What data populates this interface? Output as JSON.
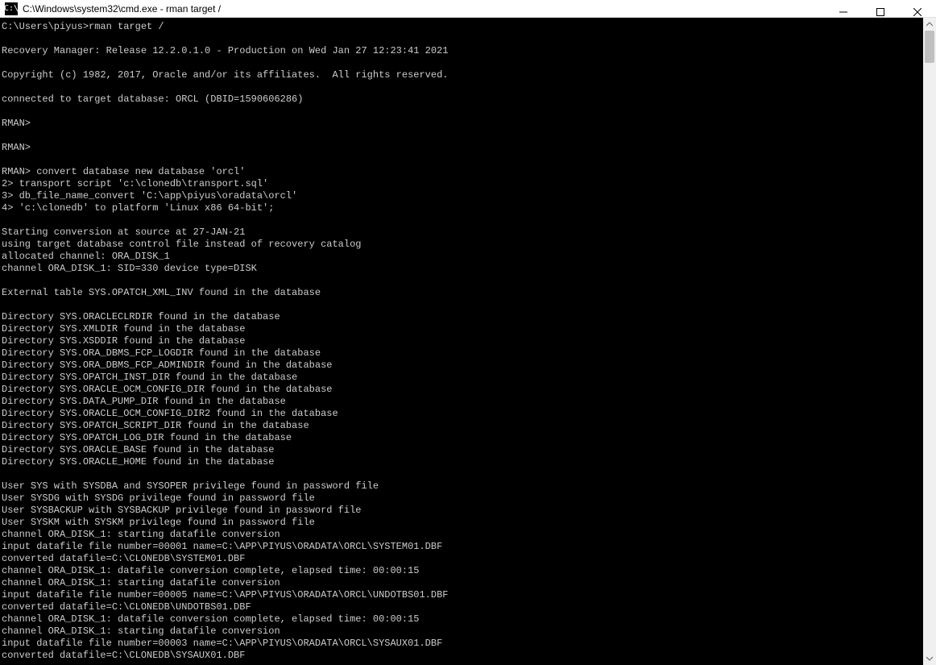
{
  "window": {
    "title": "C:\\Windows\\system32\\cmd.exe - rman  target /",
    "icon_label": "cmd-icon"
  },
  "controls": {
    "minimize": "minimize",
    "maximize": "maximize",
    "close": "close"
  },
  "terminal": {
    "lines": [
      "C:\\Users\\piyus>rman target /",
      "",
      "Recovery Manager: Release 12.2.0.1.0 - Production on Wed Jan 27 12:23:41 2021",
      "",
      "Copyright (c) 1982, 2017, Oracle and/or its affiliates.  All rights reserved.",
      "",
      "connected to target database: ORCL (DBID=1590606286)",
      "",
      "RMAN>",
      "",
      "RMAN>",
      "",
      "RMAN> convert database new database 'orcl'",
      "2> transport script 'c:\\clonedb\\transport.sql'",
      "3> db_file_name_convert 'C:\\app\\piyus\\oradata\\orcl'",
      "4> 'c:\\clonedb' to platform 'Linux x86 64-bit';",
      "",
      "Starting conversion at source at 27-JAN-21",
      "using target database control file instead of recovery catalog",
      "allocated channel: ORA_DISK_1",
      "channel ORA_DISK_1: SID=330 device type=DISK",
      "",
      "External table SYS.OPATCH_XML_INV found in the database",
      "",
      "Directory SYS.ORACLECLRDIR found in the database",
      "Directory SYS.XMLDIR found in the database",
      "Directory SYS.XSDDIR found in the database",
      "Directory SYS.ORA_DBMS_FCP_LOGDIR found in the database",
      "Directory SYS.ORA_DBMS_FCP_ADMINDIR found in the database",
      "Directory SYS.OPATCH_INST_DIR found in the database",
      "Directory SYS.ORACLE_OCM_CONFIG_DIR found in the database",
      "Directory SYS.DATA_PUMP_DIR found in the database",
      "Directory SYS.ORACLE_OCM_CONFIG_DIR2 found in the database",
      "Directory SYS.OPATCH_SCRIPT_DIR found in the database",
      "Directory SYS.OPATCH_LOG_DIR found in the database",
      "Directory SYS.ORACLE_BASE found in the database",
      "Directory SYS.ORACLE_HOME found in the database",
      "",
      "User SYS with SYSDBA and SYSOPER privilege found in password file",
      "User SYSDG with SYSDG privilege found in password file",
      "User SYSBACKUP with SYSBACKUP privilege found in password file",
      "User SYSKM with SYSKM privilege found in password file",
      "channel ORA_DISK_1: starting datafile conversion",
      "input datafile file number=00001 name=C:\\APP\\PIYUS\\ORADATA\\ORCL\\SYSTEM01.DBF",
      "converted datafile=C:\\CLONEDB\\SYSTEM01.DBF",
      "channel ORA_DISK_1: datafile conversion complete, elapsed time: 00:00:15",
      "channel ORA_DISK_1: starting datafile conversion",
      "input datafile file number=00005 name=C:\\APP\\PIYUS\\ORADATA\\ORCL\\UNDOTBS01.DBF",
      "converted datafile=C:\\CLONEDB\\UNDOTBS01.DBF",
      "channel ORA_DISK_1: datafile conversion complete, elapsed time: 00:00:15",
      "channel ORA_DISK_1: starting datafile conversion",
      "input datafile file number=00003 name=C:\\APP\\PIYUS\\ORADATA\\ORCL\\SYSAUX01.DBF",
      "converted datafile=C:\\CLONEDB\\SYSAUX01.DBF"
    ]
  }
}
